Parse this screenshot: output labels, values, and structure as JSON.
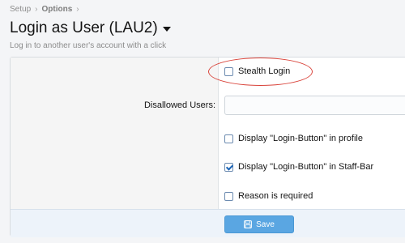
{
  "breadcrumb": {
    "items": [
      "Setup",
      "Options"
    ],
    "separator": "›"
  },
  "page": {
    "title": "Login as User (LAU2)",
    "description": "Log in to another user's account with a click"
  },
  "form": {
    "stealth_login": {
      "label": "Stealth Login",
      "checked": false
    },
    "disallowed_users": {
      "label": "Disallowed Users:",
      "value": ""
    },
    "display_profile": {
      "label": "Display \"Login-Button\" in profile",
      "checked": false
    },
    "display_staff_bar": {
      "label": "Display \"Login-Button\" in Staff-Bar",
      "checked": true
    },
    "reason_required": {
      "label": "Reason is required",
      "checked": false
    }
  },
  "footer": {
    "save_label": "Save"
  },
  "icons": {
    "title_menu": "caret-down-icon",
    "save": "floppy-disk-icon"
  },
  "colors": {
    "accent": "#5aa6e2",
    "annotation": "#d9433a",
    "checkbox_check": "#1b65b8"
  }
}
